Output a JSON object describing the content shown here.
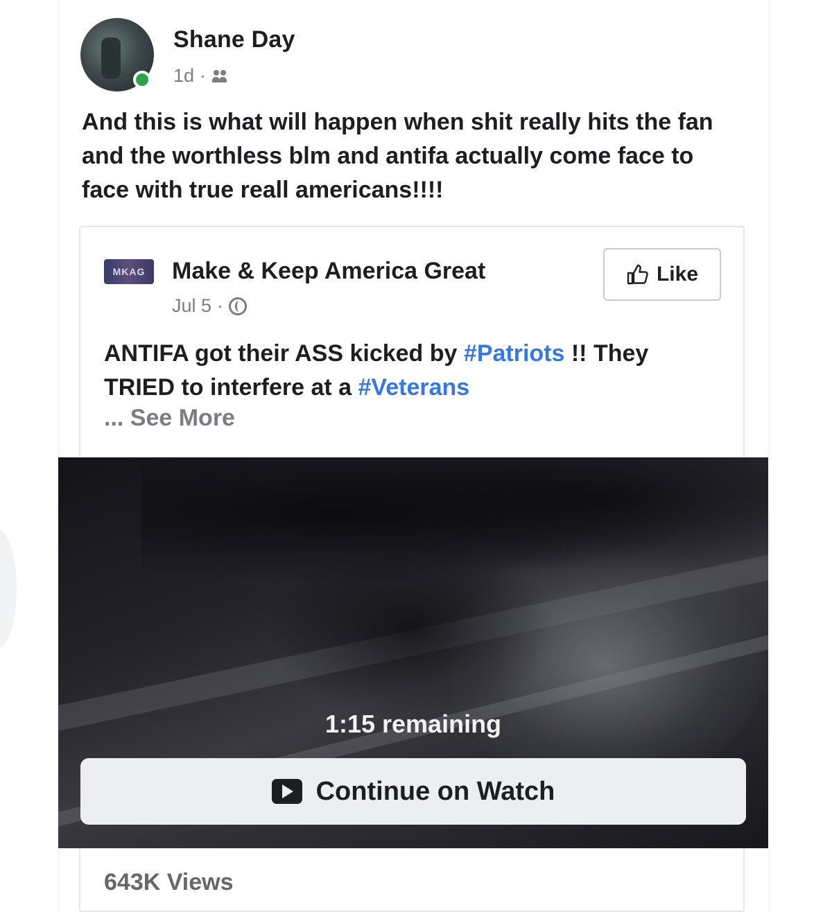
{
  "post": {
    "author": "Shane Day",
    "time": "1d",
    "separator": "·",
    "audience_icon": "friends-icon",
    "text": "And this is what will happen when shit really hits the fan and the worthless blm and antifa actually come face to face with true reall americans!!!!"
  },
  "shared": {
    "page_name": "Make & Keep America Great",
    "page_logo_text": "MKAG",
    "date": "Jul 5",
    "separator": "·",
    "audience_icon": "globe-icon",
    "like_label": "Like",
    "text_part1": "ANTIFA got their ASS kicked by ",
    "hashtag1": "#Patriots",
    "text_part2": " !! They TRIED to interfere at a ",
    "hashtag2": "#Veterans",
    "see_more": "... See More"
  },
  "video": {
    "remaining": "1:15 remaining",
    "continue_label": "Continue on Watch",
    "views": "643K Views"
  },
  "colors": {
    "hashtag": "#3578e5",
    "online": "#31a24c",
    "muted_text": "#7a7d82"
  }
}
